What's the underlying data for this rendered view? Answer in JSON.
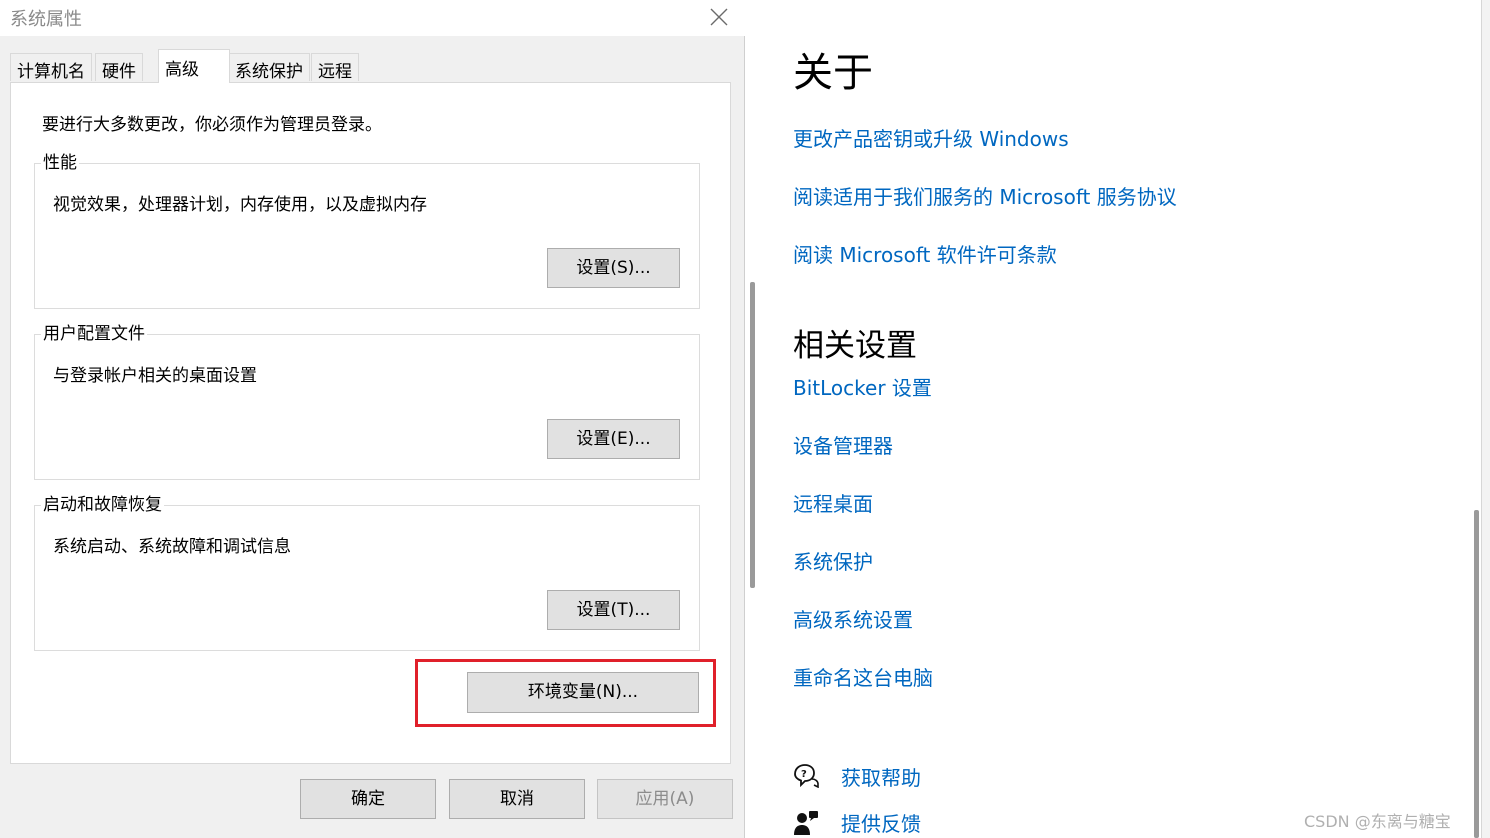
{
  "dialog": {
    "title": "系统属性",
    "tabs": [
      {
        "label": "计算机名"
      },
      {
        "label": "硬件"
      },
      {
        "label": "高级",
        "active": true
      },
      {
        "label": "系统保护"
      },
      {
        "label": "远程"
      }
    ],
    "intro": "要进行大多数更改，你必须作为管理员登录。",
    "groups": [
      {
        "legend": "性能",
        "description": "视觉效果，处理器计划，内存使用，以及虚拟内存",
        "button": "设置(S)..."
      },
      {
        "legend": "用户配置文件",
        "description": "与登录帐户相关的桌面设置",
        "button": "设置(E)..."
      },
      {
        "legend": "启动和故障恢复",
        "description": "系统启动、系统故障和调试信息",
        "button": "设置(T)..."
      }
    ],
    "env_button": "环境变量(N)...",
    "footer": {
      "ok": "确定",
      "cancel": "取消",
      "apply": "应用(A)"
    }
  },
  "settings": {
    "about_heading": "关于",
    "about_links": [
      "更改产品密钥或升级 Windows",
      "阅读适用于我们服务的 Microsoft 服务协议",
      "阅读 Microsoft 软件许可条款"
    ],
    "related_heading": "相关设置",
    "related_links": [
      "BitLocker 设置",
      "设备管理器",
      "远程桌面",
      "系统保护",
      "高级系统设置",
      "重命名这台电脑"
    ],
    "help": {
      "get_help": "获取帮助",
      "feedback": "提供反馈"
    }
  },
  "watermark": "CSDN @东离与糖宝",
  "colors": {
    "link": "#0067c0",
    "highlight": "#e0202a",
    "dialog_bg": "#f0f0f0"
  }
}
